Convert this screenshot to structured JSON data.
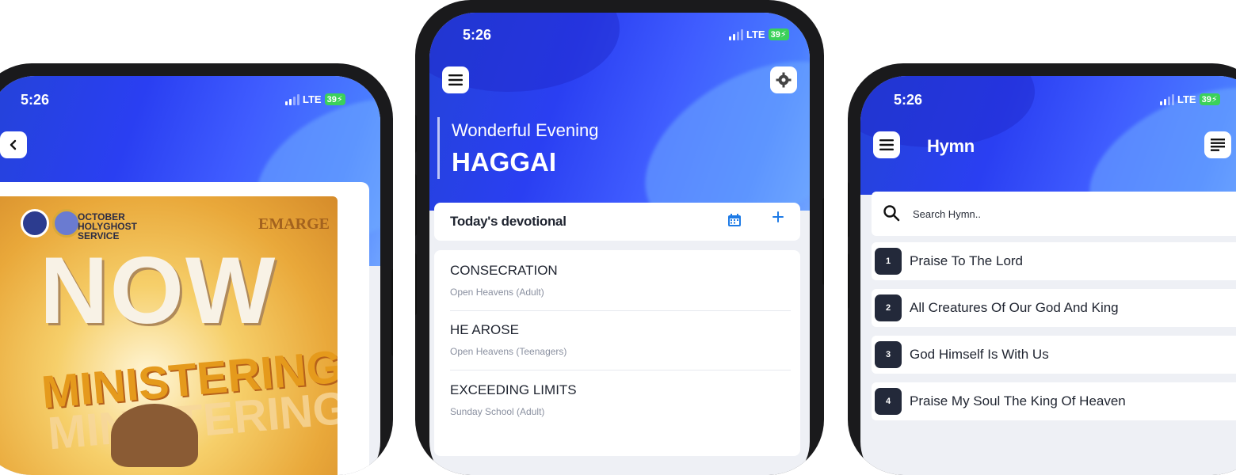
{
  "colors": {
    "accent": "#2f49ee",
    "hymn_badge": "#23293a",
    "battery": "#3bd15a",
    "calendar_blue": "#1e7be6"
  },
  "phone_left": {
    "status": {
      "time": "5:26",
      "network": "LTE",
      "battery": "39"
    },
    "back_icon": "chevron-left-icon",
    "poster": {
      "org_line1": "OCTOBER",
      "org_line2": "HOLYGHOST",
      "org_line3": "SERVICE",
      "brand": "EMARGE",
      "headline": "NOW",
      "subline": "MINISTERING",
      "subline2": "MINISTERING"
    }
  },
  "phone_center": {
    "status": {
      "time": "5:26",
      "network": "LTE",
      "battery": "39"
    },
    "greeting": "Wonderful Evening",
    "book": "HAGGAI",
    "devotional": {
      "header": "Today's devotional",
      "items": [
        {
          "title": "CONSECRATION",
          "source": "Open Heavens (Adult)"
        },
        {
          "title": "HE AROSE",
          "source": "Open Heavens (Teenagers)"
        },
        {
          "title": "EXCEEDING LIMITS",
          "source": "Sunday School (Adult)"
        }
      ]
    }
  },
  "phone_right": {
    "status": {
      "time": "5:26",
      "network": "LTE",
      "battery": "39"
    },
    "title": "Hymn",
    "search_placeholder": "Search Hymn..",
    "hymns": [
      {
        "num": "1",
        "title": "Praise To The Lord"
      },
      {
        "num": "2",
        "title": "All Creatures Of Our God And King"
      },
      {
        "num": "3",
        "title": "God Himself Is With Us"
      },
      {
        "num": "4",
        "title": "Praise My Soul The King Of Heaven"
      }
    ]
  }
}
